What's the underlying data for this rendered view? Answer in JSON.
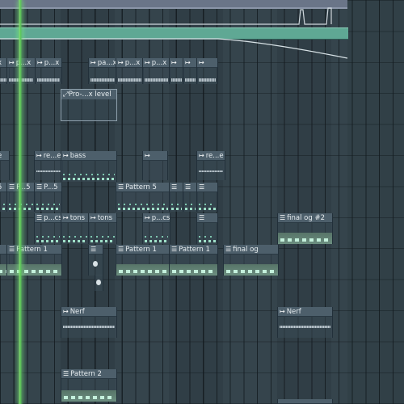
{
  "clips": {
    "r0": [
      "x",
      "p...x",
      "p...x",
      "pa...x",
      "p...x",
      "p...x"
    ],
    "automation_clip": "Pro-...x level",
    "r2": [
      "e",
      "re...e",
      "bass",
      "re...e"
    ],
    "r3": [
      "5",
      "P...5",
      "P...5",
      "Pattern 5"
    ],
    "r4": [
      "p...cs",
      "tons",
      "tons",
      "p...cs",
      "final og #2"
    ],
    "r5": [
      "Pattern 1",
      "Pattern 1",
      "Pattern 1",
      "final og"
    ],
    "r6": [
      "Nerf",
      "Nerf"
    ],
    "r7": [
      "Pattern 2"
    ]
  },
  "colors": {
    "background": "#35444c",
    "playhead": "#7bdc6a",
    "automation_lane": "#5fa894",
    "clip_header": "#4d5f6b"
  }
}
